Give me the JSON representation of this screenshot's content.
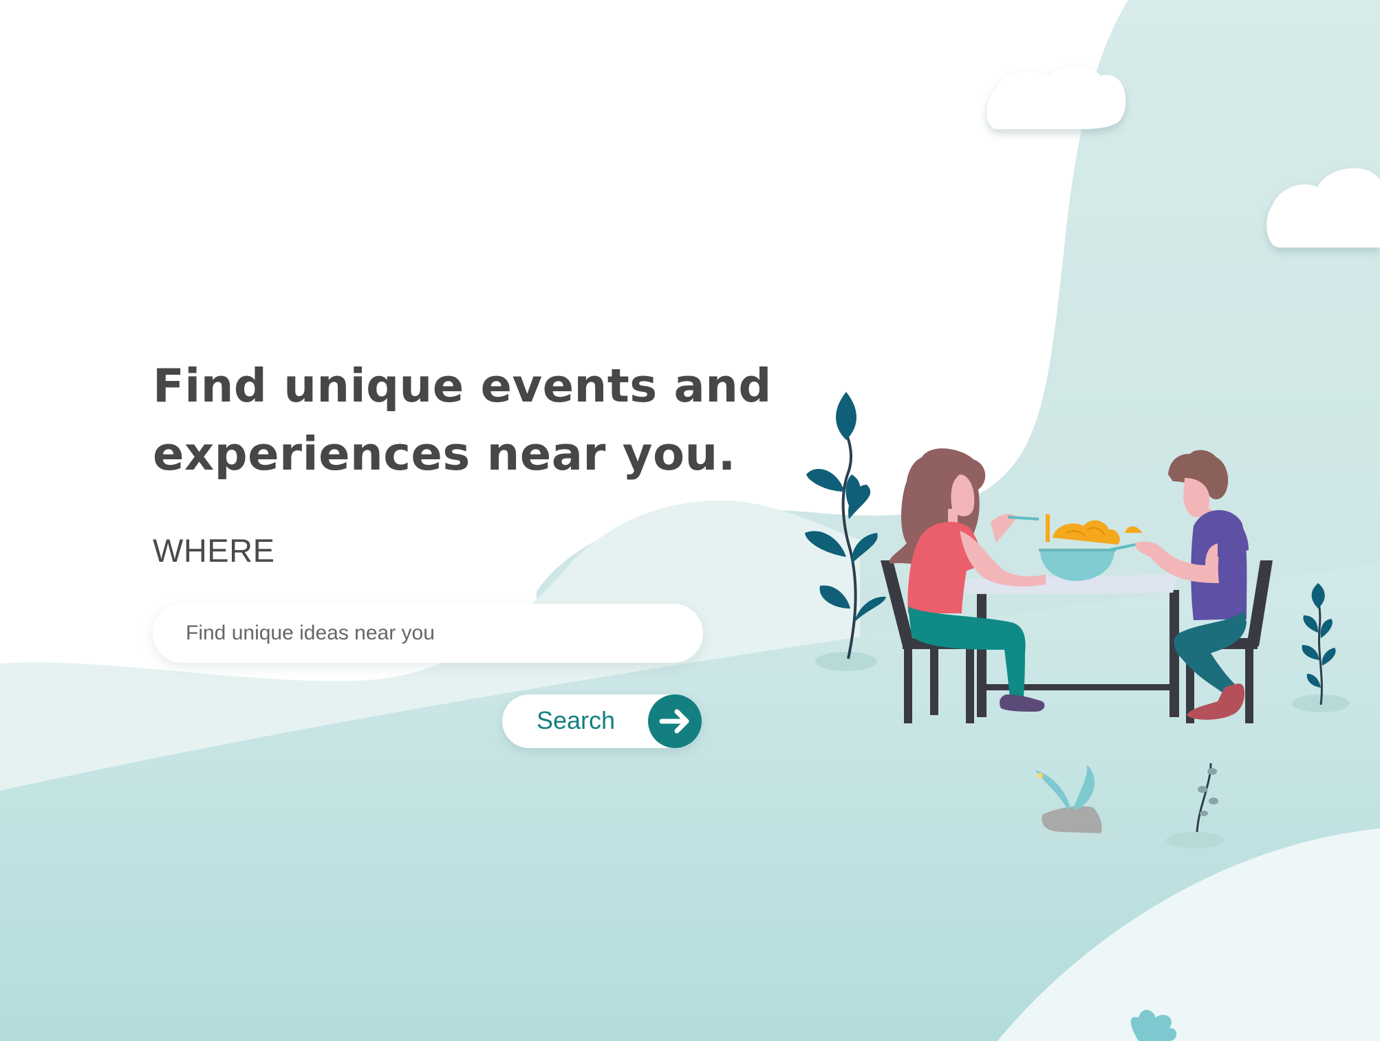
{
  "hero": {
    "headline_line1": "Find unique events and",
    "headline_line2": "experiences near you."
  },
  "search": {
    "where_label": "WHERE",
    "placeholder": "Find unique ideas near you",
    "value": "",
    "button_label": "Search",
    "button_icon": "arrow-right-icon"
  },
  "colors": {
    "accent": "#137f80",
    "heading": "#474747",
    "background_teal": "#c4e3e3"
  }
}
